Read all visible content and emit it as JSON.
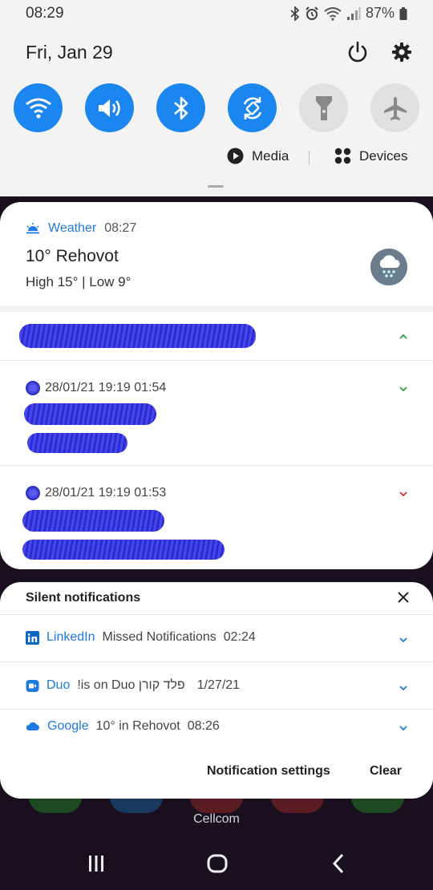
{
  "status_bar": {
    "time": "08:29",
    "battery": "87%",
    "icons": [
      "bluetooth-icon",
      "alarm-icon",
      "wifi-icon",
      "signal-icon",
      "battery-icon"
    ]
  },
  "header": {
    "date": "Fri, Jan 29",
    "icons": [
      "power-icon",
      "gear-icon"
    ]
  },
  "quick_settings": {
    "tiles": [
      {
        "name": "wifi",
        "state": "on"
      },
      {
        "name": "sound",
        "state": "on"
      },
      {
        "name": "bluetooth",
        "state": "on"
      },
      {
        "name": "auto-rotate",
        "state": "on"
      },
      {
        "name": "flashlight",
        "state": "off"
      },
      {
        "name": "airplane",
        "state": "off"
      }
    ],
    "active_color": "#1b86f0",
    "inactive_color": "#e0e0e0"
  },
  "media_row": {
    "media_label": "Media",
    "devices_label": "Devices"
  },
  "weather": {
    "app_name": "Weather",
    "time": "08:27",
    "title": "10° Rehovot",
    "subtitle": "High 15° | Low 9°"
  },
  "messages": [
    {
      "timestamp": "28/01/21 19:19 01:54"
    },
    {
      "timestamp": "28/01/21 19:19 01:53"
    }
  ],
  "silent": {
    "title": "Silent notifications",
    "rows": [
      {
        "app": "LinkedIn",
        "text": "Missed Notifications",
        "time": "02:24"
      },
      {
        "app": "Duo",
        "text": "!is on Duo פלד קורן",
        "time": "1/27/21"
      },
      {
        "app": "Google",
        "text": "10° in Rehovot",
        "time": "08:26"
      }
    ],
    "notification_settings_label": "Notification settings",
    "clear_label": "Clear"
  },
  "home": {
    "carrier": "Cellcom"
  },
  "colors": {
    "accent_blue": "#1f7ae0",
    "redaction": "#2b2bd6",
    "chevron_green": "#2e9c3a",
    "chevron_red": "#d32f2f"
  }
}
